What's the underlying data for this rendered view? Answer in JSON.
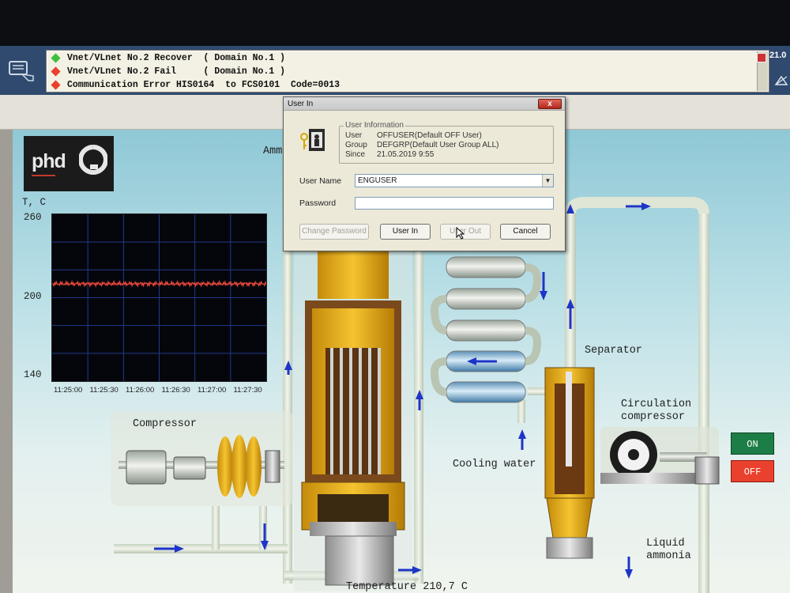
{
  "alarms": [
    {
      "status": "green",
      "text": "Vnet/VLnet No.2 Recover  ( Domain No.1 )"
    },
    {
      "status": "red",
      "text": "Vnet/VLnet No.2 Fail     ( Domain No.1 )"
    },
    {
      "status": "red",
      "text": "Communication Error HIS0164  to FCS0101  Code=0013"
    }
  ],
  "clock": "21.0",
  "colors": {
    "alarm_green": "#3fbf3f",
    "alarm_red": "#e8402c",
    "on": "#1c7e46",
    "off": "#e9412d",
    "trend_line": "#e5473a",
    "arrow": "#1d35c8"
  },
  "graphic": {
    "logo": "phd",
    "title_partial": "Amm",
    "trend": {
      "ylabel": "T, C",
      "y_ticks": [
        "260",
        "200",
        "140"
      ],
      "x_ticks": [
        "11:25:00",
        "11:25:30",
        "11:26:00",
        "11:26:30",
        "11:27:00",
        "11:27:30"
      ]
    },
    "labels": {
      "compressor": "Compressor",
      "separator": "Separator",
      "circulation_1": "Circulation",
      "circulation_2": "compressor",
      "cooling_water": "Cooling water",
      "liquid_1": "Liquid",
      "liquid_2": "ammonia",
      "temperature": "Temperature  210,7 C"
    },
    "buttons": {
      "on": "ON",
      "off": "OFF"
    }
  },
  "chart_data": {
    "type": "line",
    "title": "",
    "xlabel": "",
    "ylabel": "T, C",
    "ylim": [
      140,
      260
    ],
    "x": [
      "11:25:00",
      "11:25:30",
      "11:26:00",
      "11:26:30",
      "11:27:00",
      "11:27:30"
    ],
    "series": [
      {
        "values": [
          210,
          210,
          210,
          210,
          210,
          210
        ]
      }
    ],
    "grid": true
  },
  "dialog": {
    "title": "User In",
    "close": "x",
    "group_title": "User Information",
    "user_key": "User",
    "user_val": "OFFUSER(Default OFF User)",
    "group_key": "Group",
    "group_val": "DEFGRP(Default User Group ALL)",
    "since_key": "Since",
    "since_val": "21.05.2019 9:55",
    "username_label": "User Name",
    "username_value": "ENGUSER",
    "password_label": "Password",
    "change_password": "Change Password",
    "user_in": "User In",
    "user_out": "User Out",
    "cancel": "Cancel"
  }
}
